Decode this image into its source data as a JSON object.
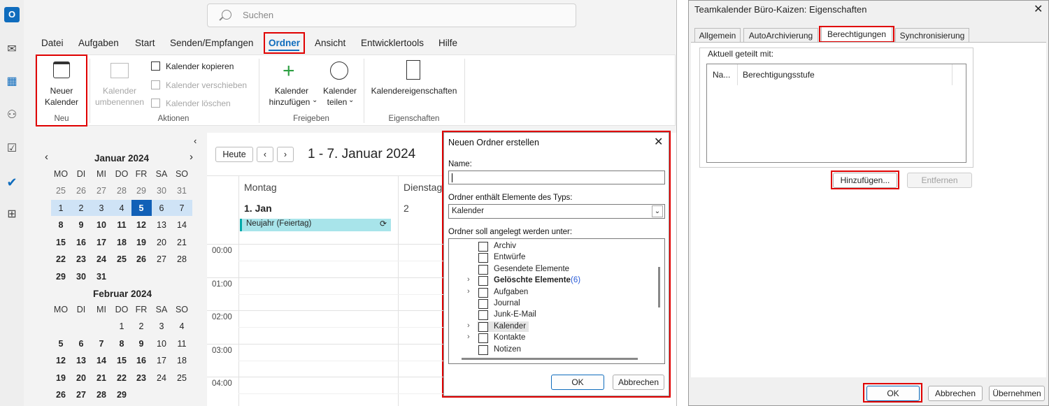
{
  "outlook": {
    "search_placeholder": "Suchen",
    "menu": [
      "Datei",
      "Aufgaben",
      "Start",
      "Senden/Empfangen",
      "Ordner",
      "Ansicht",
      "Entwicklertools",
      "Hilfe"
    ],
    "ribbon": {
      "new_calendar": [
        "Neuer",
        "Kalender"
      ],
      "rename": [
        "Kalender",
        "umbenennen"
      ],
      "copy": "Kalender kopieren",
      "move": "Kalender verschieben",
      "delete": "Kalender löschen",
      "add": [
        "Kalender",
        "hinzufügen"
      ],
      "share": [
        "Kalender",
        "teilen"
      ],
      "properties": "Kalendereigenschaften",
      "groups": {
        "neu": "Neu",
        "aktionen": "Aktionen",
        "freigeben": "Freigeben",
        "eigenschaften": "Eigenschaften"
      }
    },
    "mini_calendar": {
      "month1": "Januar 2024",
      "month2": "Februar 2024",
      "weekdays": [
        "MO",
        "DI",
        "MI",
        "DO",
        "FR",
        "SA",
        "SO"
      ],
      "jan_rows": [
        [
          "25",
          "26",
          "27",
          "28",
          "29",
          "30",
          "31"
        ],
        [
          "1",
          "2",
          "3",
          "4",
          "5",
          "6",
          "7"
        ],
        [
          "8",
          "9",
          "10",
          "11",
          "12",
          "13",
          "14"
        ],
        [
          "15",
          "16",
          "17",
          "18",
          "19",
          "20",
          "21"
        ],
        [
          "22",
          "23",
          "24",
          "25",
          "26",
          "27",
          "28"
        ],
        [
          "29",
          "30",
          "31",
          "",
          "",
          "",
          ""
        ]
      ],
      "feb_rows": [
        [
          "",
          "",
          "",
          "1",
          "2",
          "3",
          "4"
        ],
        [
          "5",
          "6",
          "7",
          "8",
          "9",
          "10",
          "11"
        ],
        [
          "12",
          "13",
          "14",
          "15",
          "16",
          "17",
          "18"
        ],
        [
          "19",
          "20",
          "21",
          "22",
          "23",
          "24",
          "25"
        ],
        [
          "26",
          "27",
          "28",
          "29",
          "",
          "",
          ""
        ]
      ]
    },
    "calendar": {
      "today_btn": "Heute",
      "range": "1 - 7. Januar 2024",
      "day1": "Montag",
      "day1_date": "1. Jan",
      "day2": "Dienstag",
      "day2_date": "2",
      "event": "Neujahr (Feiertag)",
      "times": [
        "00:00",
        "01:00",
        "02:00",
        "03:00",
        "04:00"
      ]
    }
  },
  "dialog_new_folder": {
    "title": "Neuen Ordner erstellen",
    "name_label": "Name:",
    "name_value": "",
    "type_label": "Ordner enthält Elemente des Typs:",
    "type_value": "Kalender",
    "location_label": "Ordner soll angelegt werden unter:",
    "tree": [
      {
        "label": "Archiv",
        "expand": false,
        "bold": false
      },
      {
        "label": "Entwürfe",
        "expand": false,
        "bold": false
      },
      {
        "label": "Gesendete Elemente",
        "expand": false,
        "bold": false
      },
      {
        "label": "Gelöschte Elemente",
        "expand": true,
        "bold": true,
        "count": "(6)"
      },
      {
        "label": "Aufgaben",
        "expand": true,
        "bold": false
      },
      {
        "label": "Journal",
        "expand": false,
        "bold": false
      },
      {
        "label": "Junk-E-Mail",
        "expand": false,
        "bold": false
      },
      {
        "label": "Kalender",
        "expand": true,
        "bold": false,
        "selected": true
      },
      {
        "label": "Kontakte",
        "expand": true,
        "bold": false
      },
      {
        "label": "Notizen",
        "expand": false,
        "bold": false
      }
    ],
    "ok": "OK",
    "cancel": "Abbrechen"
  },
  "dialog_properties": {
    "title": "Teamkalender Büro-Kaizen: Eigenschaften",
    "tabs": [
      "Allgemein",
      "AutoArchivierung",
      "Berechtigungen",
      "Synchronisierung"
    ],
    "shared_label": "Aktuell geteilt mit:",
    "col_name": "Na...",
    "col_level": "Berechtigungsstufe",
    "add": "Hinzufügen...",
    "remove": "Entfernen",
    "ok": "OK",
    "cancel": "Abbrechen",
    "apply": "Übernehmen"
  },
  "colors": {
    "accent": "#0f6cbd",
    "highlight": "#e00000",
    "event": "#a8e4ea"
  }
}
